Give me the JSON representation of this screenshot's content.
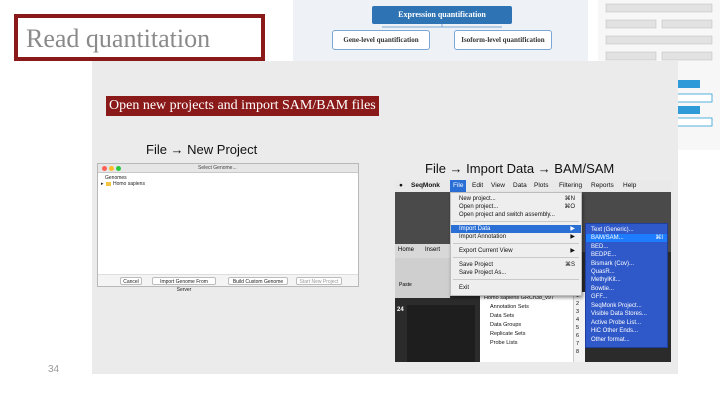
{
  "title": "Read quantitation",
  "diagram": {
    "top_label": "Expression quantification",
    "gene_label": "Gene-level quantification",
    "isoform_label": "Isoform-level quantification"
  },
  "heading": "Open new projects and import SAM/BAM files",
  "label_new_project": "File → New Project",
  "label_import": "File → Import Data → BAM/SAM",
  "page_number": "34",
  "left_window": {
    "title": "Select Genome...",
    "tree": [
      "Genomes",
      "Homo sapiens"
    ],
    "buttons": [
      "Cancel",
      "Import Genome From Server",
      "Build Custom Genome",
      "Start New Project"
    ]
  },
  "right_window": {
    "menubar": [
      "SeqMonk",
      "File",
      "Edit",
      "View",
      "Data",
      "Plots",
      "Filtering",
      "Reports",
      "Help"
    ],
    "file_menu": [
      {
        "label": "New project...",
        "shortcut": "⌘N"
      },
      {
        "label": "Open project...",
        "shortcut": "⌘O"
      },
      {
        "label": "Open project and switch assembly...",
        "shortcut": ""
      },
      {
        "label": "Import Data",
        "shortcut": "▶"
      },
      {
        "label": "Import Annotation",
        "shortcut": "▶"
      },
      {
        "label": "Export Current View",
        "shortcut": "▶"
      },
      {
        "label": "Save Project",
        "shortcut": "⌘S"
      },
      {
        "label": "Save Project As...",
        "shortcut": ""
      },
      {
        "label": "Exit",
        "shortcut": ""
      }
    ],
    "submenu": [
      {
        "label": "Text (Generic)...",
        "shortcut": ""
      },
      {
        "label": "BAM/SAM...",
        "shortcut": "⌘I"
      },
      {
        "label": "BED...",
        "shortcut": ""
      },
      {
        "label": "BEDPE...",
        "shortcut": ""
      },
      {
        "label": "Bismark (Cov)...",
        "shortcut": ""
      },
      {
        "label": "QuasR...",
        "shortcut": ""
      },
      {
        "label": "MethylKit...",
        "shortcut": ""
      },
      {
        "label": "Bowtie...",
        "shortcut": ""
      },
      {
        "label": "GFF...",
        "shortcut": ""
      },
      {
        "label": "SeqMonk Project...",
        "shortcut": ""
      },
      {
        "label": "Visible Data Stores...",
        "shortcut": ""
      },
      {
        "label": "Active Probe List...",
        "shortcut": ""
      },
      {
        "label": "HiC Other Ends...",
        "shortcut": ""
      },
      {
        "label": "Other format...",
        "shortcut": ""
      }
    ],
    "tree_title": "Homo sapiens GRCh38_v97",
    "tree_items": [
      "Annotation Sets",
      "Data Sets",
      "Data Groups",
      "Replicate Sets",
      "Probe Lists"
    ],
    "row_numbers": [
      "1",
      "2",
      "3",
      "4",
      "5",
      "6",
      "7",
      "8"
    ],
    "tab_home": "Home",
    "tab_insert": "Insert",
    "paste_label": "Paste",
    "side_number": "24"
  },
  "colors": {
    "accent": "#8a1a1a",
    "menu_select": "#2a6fd6",
    "submenu": "#2f58c9"
  }
}
